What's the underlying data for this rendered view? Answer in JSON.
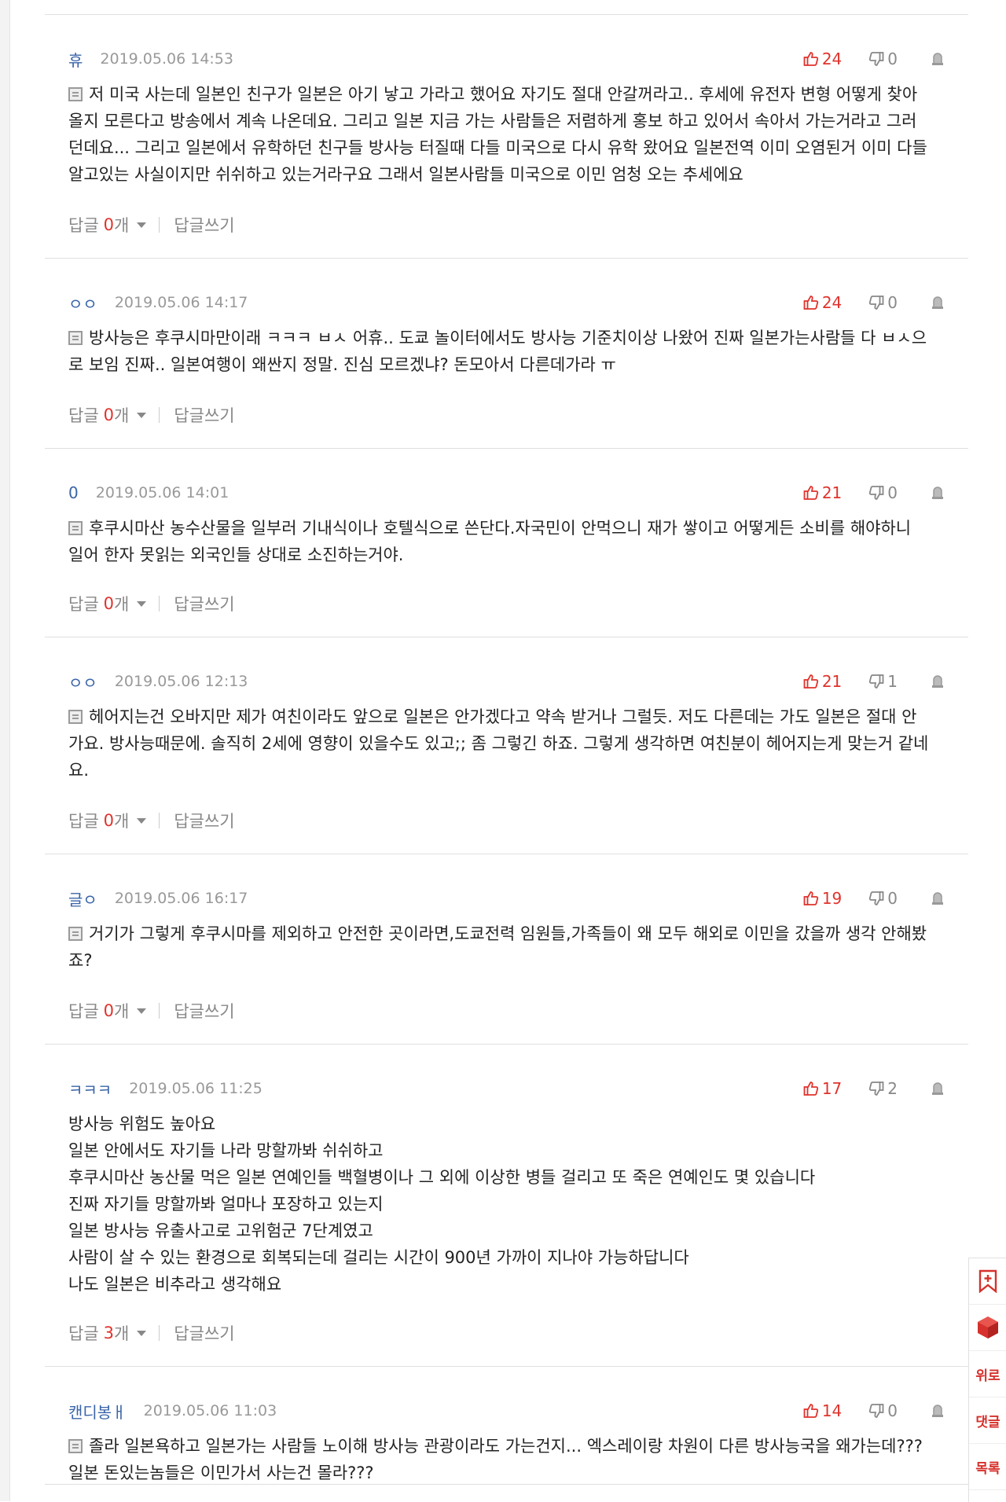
{
  "reply_label": "답글",
  "reply_unit": "개",
  "write_reply_label": "답글쓰기",
  "accent_color": "#e0332d",
  "comments": [
    {
      "nick": "휴",
      "date": "2019.05.06 14:53",
      "up": "24",
      "down": "0",
      "has_memo_icon": true,
      "lines": [
        "저 미국 사는데 일본인 친구가 일본은 아기 낳고 가라고 했어요 자기도 절대 안갈꺼라고.. 후세에 유전자 변형 어떻게 찾아",
        "올지 모른다고 방송에서 계속 나온데요. 그리고 일본 지금 가는 사람들은 저렴하게 홍보 하고 있어서 속아서 가는거라고 그러",
        "던데요... 그리고 일본에서 유학하던 친구들 방사능 터질때 다들 미국으로 다시 유학 왔어요 일본전역 이미 오염된거 이미 다들",
        "알고있는 사실이지만 쉬쉬하고 있는거라구요 그래서 일본사람들 미국으로 이민 엄청 오는 추세에요"
      ],
      "replies": "0"
    },
    {
      "nick": "ㅇㅇ",
      "date": "2019.05.06 14:17",
      "up": "24",
      "down": "0",
      "has_memo_icon": true,
      "lines": [
        "방사능은 후쿠시마만이래 ㅋㅋㅋ ㅂㅅ 어휴.. 도쿄 놀이터에서도 방사능 기준치이상 나왔어 진짜 일본가는사람들 다 ㅂㅅ으",
        "로 보임 진짜.. 일본여행이 왜싼지 정말. 진심 모르겠냐? 돈모아서 다른데가라 ㅠ"
      ],
      "replies": "0"
    },
    {
      "nick": "0",
      "date": "2019.05.06 14:01",
      "up": "21",
      "down": "0",
      "has_memo_icon": true,
      "lines": [
        "후쿠시마산 농수산물을 일부러 기내식이나 호텔식으로 쓴단다.자국민이 안먹으니 재가 쌓이고 어떻게든 소비를 해야하니",
        "일어 한자 못읽는 외국인들 상대로 소진하는거야."
      ],
      "replies": "0"
    },
    {
      "nick": "ㅇㅇ",
      "date": "2019.05.06 12:13",
      "up": "21",
      "down": "1",
      "has_memo_icon": true,
      "lines": [
        "헤어지는건 오바지만 제가 여친이라도 앞으로 일본은 안가겠다고 약속 받거나 그럴듯. 저도 다른데는 가도 일본은 절대 안",
        "가요. 방사능때문에. 솔직히 2세에 영향이 있을수도 있고;; 좀 그렇긴 하죠. 그렇게 생각하면 여친분이 헤어지는게 맞는거 같네",
        "요."
      ],
      "replies": "0"
    },
    {
      "nick": "글ㅇ",
      "date": "2019.05.06 16:17",
      "up": "19",
      "down": "0",
      "has_memo_icon": true,
      "lines": [
        "거기가 그렇게 후쿠시마를 제외하고 안전한 곳이라면,도쿄전력 임원들,가족들이 왜 모두 해외로 이민을 갔을까 생각 안해봤",
        "죠?"
      ],
      "replies": "0"
    },
    {
      "nick": "ㅋㅋㅋ",
      "date": "2019.05.06 11:25",
      "up": "17",
      "down": "2",
      "has_memo_icon": false,
      "lines": [
        "방사능 위험도 높아요",
        "일본 안에서도 자기들 나라 망할까봐 쉬쉬하고",
        "후쿠시마산 농산물 먹은 일본 연예인들 백혈병이나 그 외에 이상한 병들 걸리고 또 죽은 연예인도 몇 있습니다",
        "진짜 자기들 망할까봐 얼마나 포장하고 있는지",
        "일본 방사능 유출사고로 고위험군 7단계였고",
        "사람이 살 수 있는 환경으로 회복되는데 걸리는 시간이 900년 가까이 지나야 가능하답니다",
        "나도 일본은 비추라고 생각해요"
      ],
      "replies": "3"
    },
    {
      "nick": "캔디봉ㅐ",
      "date": "2019.05.06 11:03",
      "up": "14",
      "down": "0",
      "has_memo_icon": true,
      "lines": [
        "졸라 일본욕하고 일본가는 사람들 노이해 방사능 관광이라도 가는건지... 엑스레이랑 차원이 다른 방사능국을 왜가는데???",
        "일본 돈있는놈들은 이민가서 사는건 몰라???"
      ],
      "replies": ""
    }
  ],
  "side_buttons": {
    "bookmark_icon": "bookmark-icon",
    "cube_icon": "cube-icon",
    "top_label": "위로",
    "comment_label": "댓글",
    "list_label": "목록"
  }
}
